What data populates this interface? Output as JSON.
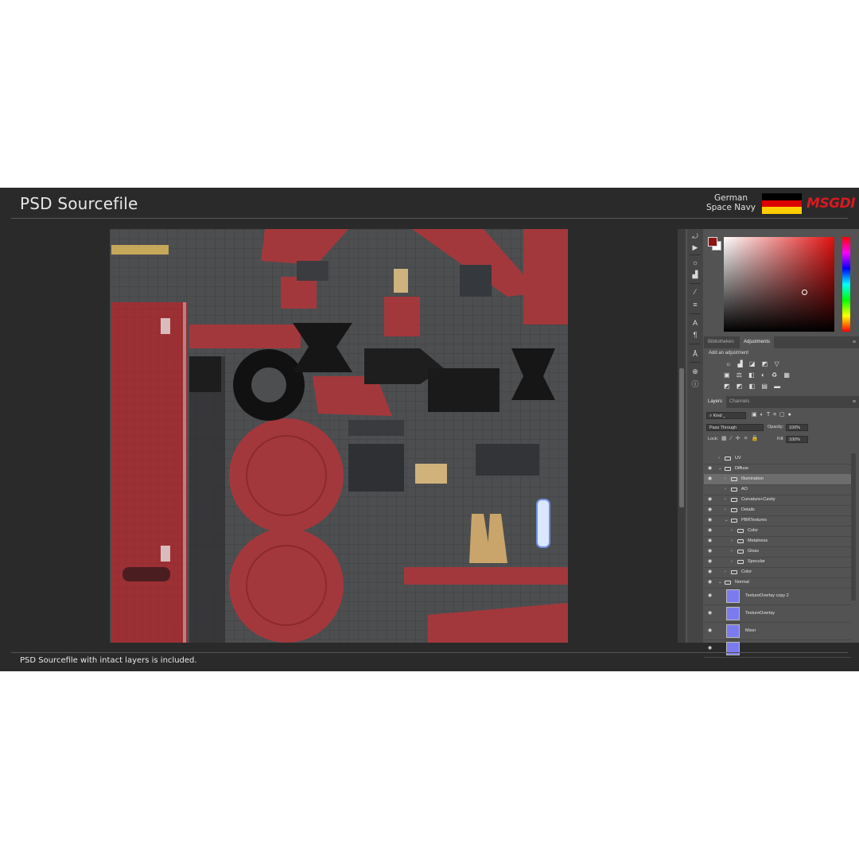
{
  "header": {
    "title": "PSD Sourcefile",
    "brand_line1": "German",
    "brand_line2": "Space Navy",
    "logo": "MSGDI",
    "flag_colors": [
      "#000000",
      "#dd0000",
      "#ffce00"
    ]
  },
  "caption": "PSD Sourcefile with intact layers is included.",
  "photoshop": {
    "tools": [
      "rotate-icon",
      "play-icon",
      "brightness-icon",
      "levels-icon",
      "brush-icon",
      "sliders-icon",
      "type-icon",
      "paragraph-icon",
      "glyph-icon",
      "stamp-icon",
      "info-icon"
    ],
    "color": {
      "foreground": "#8f1414",
      "background": "#ffffff"
    },
    "top_tabs": [
      "Bibliotheken",
      "Adjustments"
    ],
    "adjustments_title": "Add an adjustment",
    "layer_tabs": [
      "Layers",
      "Channels"
    ],
    "kind_filter": "Kind",
    "blend_mode": "Pass Through",
    "opacity_label": "Opacity:",
    "opacity_value": "100%",
    "lock_label": "Lock:",
    "fill_label": "Fill:",
    "fill_value": "100%",
    "layers": [
      {
        "name": "UV",
        "type": "folder",
        "indent": 0,
        "visible": false,
        "open": false
      },
      {
        "name": "Diffuse",
        "type": "folder",
        "indent": 0,
        "visible": true,
        "open": true
      },
      {
        "name": "Illumination",
        "type": "folder",
        "indent": 1,
        "visible": true,
        "open": false,
        "selected": true
      },
      {
        "name": "AO",
        "type": "folder",
        "indent": 1,
        "visible": false,
        "open": false
      },
      {
        "name": "Curvature+Cavity",
        "type": "folder",
        "indent": 1,
        "visible": true,
        "open": false
      },
      {
        "name": "Details",
        "type": "folder",
        "indent": 1,
        "visible": true,
        "open": false
      },
      {
        "name": "PBRTextures",
        "type": "folder",
        "indent": 1,
        "visible": true,
        "open": true
      },
      {
        "name": "Color",
        "type": "folder",
        "indent": 2,
        "visible": true,
        "open": false
      },
      {
        "name": "Metalness",
        "type": "folder",
        "indent": 2,
        "visible": true,
        "open": false
      },
      {
        "name": "Gloss",
        "type": "folder",
        "indent": 2,
        "visible": true,
        "open": false
      },
      {
        "name": "Specular",
        "type": "folder",
        "indent": 2,
        "visible": true,
        "open": false
      },
      {
        "name": "Color",
        "type": "folder",
        "indent": 1,
        "visible": true,
        "open": false
      },
      {
        "name": "Normal",
        "type": "folder",
        "indent": 0,
        "visible": true,
        "open": true
      },
      {
        "name": "TextureOverlay copy 2",
        "type": "layer",
        "indent": 1,
        "visible": true
      },
      {
        "name": "TextureOverlay",
        "type": "layer",
        "indent": 1,
        "visible": true
      },
      {
        "name": "Mixer",
        "type": "layer",
        "indent": 1,
        "visible": true
      },
      {
        "name": "",
        "type": "layer",
        "indent": 1,
        "visible": true
      }
    ]
  }
}
